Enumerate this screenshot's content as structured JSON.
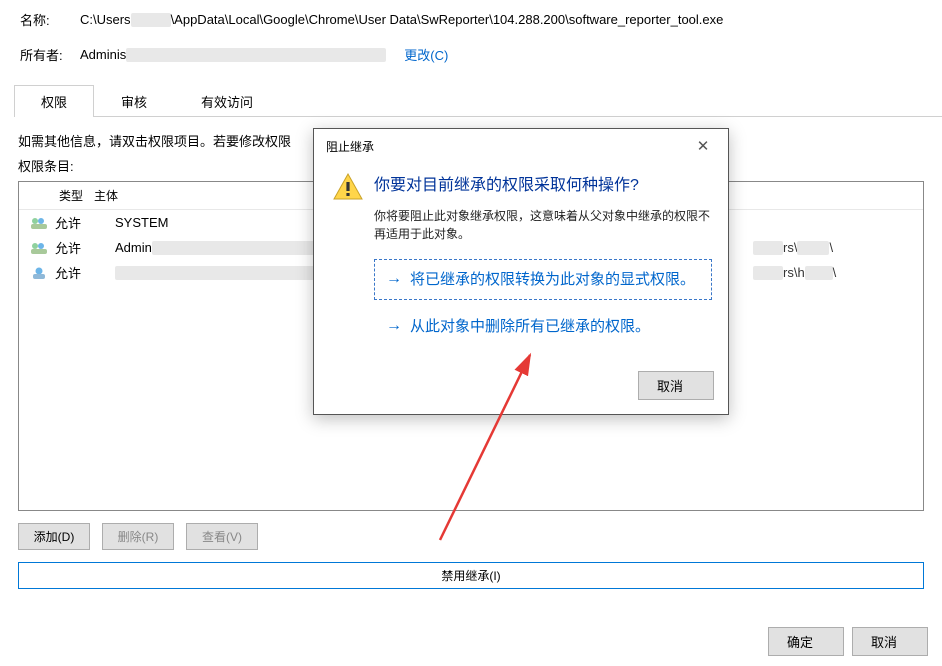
{
  "header": {
    "name_label": "名称:",
    "name_value_pre": "C:\\Users",
    "name_value_post": "\\AppData\\Local\\Google\\Chrome\\User Data\\SwReporter\\104.288.200\\software_reporter_tool.exe",
    "owner_label": "所有者:",
    "owner_value": "Adminis",
    "change_link": "更改(C)"
  },
  "tabs": {
    "t0": "权限",
    "t1": "审核",
    "t2": "有效访问"
  },
  "hint": "如需其他信息，请双击权限项目。若要修改权限",
  "perm_label": "权限条目:",
  "cols": {
    "type": "类型",
    "principal": "主体"
  },
  "rows": [
    {
      "allow": "允许",
      "principal": "SYSTEM",
      "inherit_pre": "",
      "inherit_post": ""
    },
    {
      "allow": "允许",
      "principal": "Admin",
      "inherit_pre": "rs\\",
      "inherit_post": "\\"
    },
    {
      "allow": "允许",
      "principal": "",
      "inherit_pre": "rs\\h",
      "inherit_post": "\\"
    }
  ],
  "buttons": {
    "add": "添加(D)",
    "remove": "删除(R)",
    "view": "查看(V)",
    "disable_inherit": "禁用继承(I)",
    "ok": "确定",
    "cancel": "取消"
  },
  "modal": {
    "title": "阻止继承",
    "heading": "你要对目前继承的权限采取何种操作?",
    "text": "你将要阻止此对象继承权限，这意味着从父对象中继承的权限不再适用于此对象。",
    "option1": "将已继承的权限转换为此对象的显式权限。",
    "option2": "从此对象中删除所有已继承的权限。",
    "cancel": "取消"
  }
}
